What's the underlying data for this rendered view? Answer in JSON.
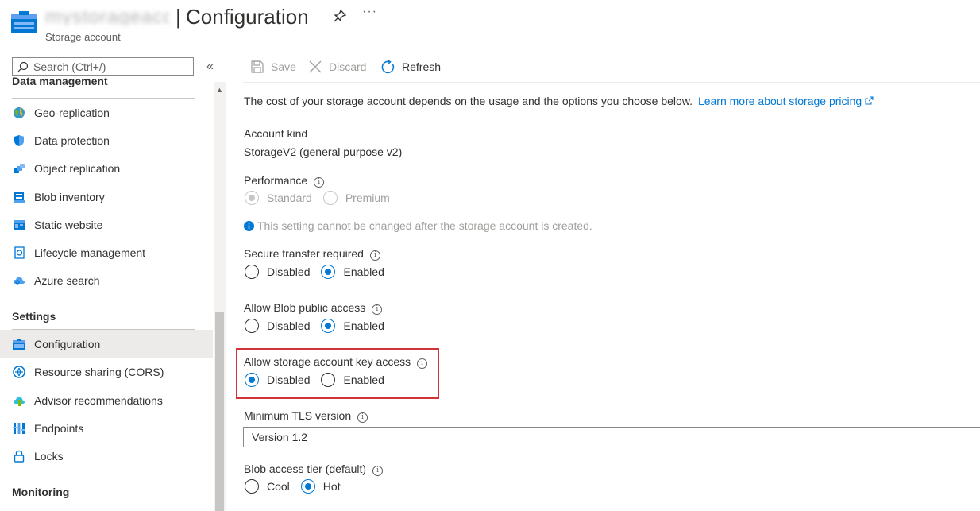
{
  "header": {
    "account_name": "mystorageacct",
    "separator": "|",
    "title": "Configuration",
    "subtitle": "Storage account",
    "more": "···"
  },
  "sidebar": {
    "search_placeholder": "Search (Ctrl+/)",
    "collapse": "«",
    "partial_section": "Data management",
    "data_management_items": [
      {
        "label": "Geo-replication",
        "icon": "globe-icon"
      },
      {
        "label": "Data protection",
        "icon": "shield-icon"
      },
      {
        "label": "Object replication",
        "icon": "object-replication-icon"
      },
      {
        "label": "Blob inventory",
        "icon": "inventory-icon"
      },
      {
        "label": "Static website",
        "icon": "website-icon"
      },
      {
        "label": "Lifecycle management",
        "icon": "lifecycle-icon"
      },
      {
        "label": "Azure search",
        "icon": "cloud-search-icon"
      }
    ],
    "settings_heading": "Settings",
    "settings_items": [
      {
        "label": "Configuration",
        "icon": "configuration-icon",
        "active": true
      },
      {
        "label": "Resource sharing (CORS)",
        "icon": "cors-icon"
      },
      {
        "label": "Advisor recommendations",
        "icon": "advisor-icon"
      },
      {
        "label": "Endpoints",
        "icon": "endpoints-icon"
      },
      {
        "label": "Locks",
        "icon": "lock-icon"
      }
    ],
    "monitoring_heading": "Monitoring"
  },
  "toolbar": {
    "save": "Save",
    "discard": "Discard",
    "refresh": "Refresh"
  },
  "main": {
    "intro": "The cost of your storage account depends on the usage and the options you choose below.",
    "learn_more": "Learn more about storage pricing",
    "account_kind_label": "Account kind",
    "account_kind_value": "StorageV2 (general purpose v2)",
    "performance_label": "Performance",
    "performance_options": [
      "Standard",
      "Premium"
    ],
    "performance_selected": "Standard",
    "performance_note": "This setting cannot be changed after the storage account is created.",
    "secure_transfer_label": "Secure transfer required",
    "blob_public_label": "Allow Blob public access",
    "key_access_label": "Allow storage account key access",
    "disabled": "Disabled",
    "enabled": "Enabled",
    "secure_transfer_selected": "Enabled",
    "blob_public_selected": "Enabled",
    "key_access_selected": "Disabled",
    "tls_label": "Minimum TLS version",
    "tls_value": "Version 1.2",
    "tier_label": "Blob access tier (default)",
    "tier_options": [
      "Cool",
      "Hot"
    ],
    "tier_selected": "Hot"
  },
  "colors": {
    "accent": "#0078d4",
    "highlight": "#d13438",
    "active_bg": "#edebe9"
  }
}
